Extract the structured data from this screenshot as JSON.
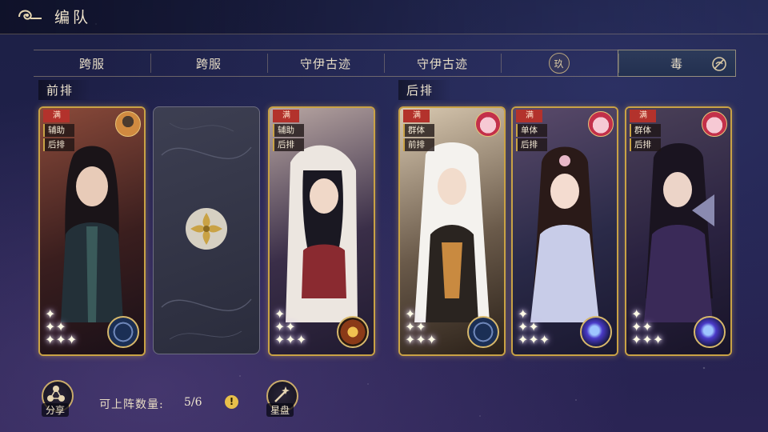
{
  "header": {
    "title": "编队"
  },
  "tabs": [
    {
      "label": "跨服"
    },
    {
      "label": "跨服"
    },
    {
      "label": "守伊古迹"
    },
    {
      "label": "守伊古迹"
    },
    {
      "label": "",
      "icon_text": "玖"
    },
    {
      "label": "毒",
      "active": true
    }
  ],
  "sections": {
    "front": "前排",
    "back": "后排"
  },
  "cards": [
    {
      "full": "满",
      "role": "辅助",
      "row": "后排",
      "stars": 3,
      "emblem": "blue"
    },
    {
      "full": "满",
      "role": "辅助",
      "row": "后排",
      "stars": 3,
      "emblem": "orange"
    },
    {
      "full": "满",
      "role": "群体",
      "row": "前排",
      "stars": 3,
      "emblem": "blue"
    },
    {
      "full": "满",
      "role": "单体",
      "row": "后排",
      "stars": 3,
      "emblem": "purple"
    },
    {
      "full": "满",
      "role": "群体",
      "row": "后排",
      "stars": 3,
      "emblem": "purple"
    }
  ],
  "footer": {
    "share": "分享",
    "deploy_label": "可上阵数量:",
    "deploy_count": "5/6",
    "warn": "!",
    "star_map": "星盘"
  }
}
